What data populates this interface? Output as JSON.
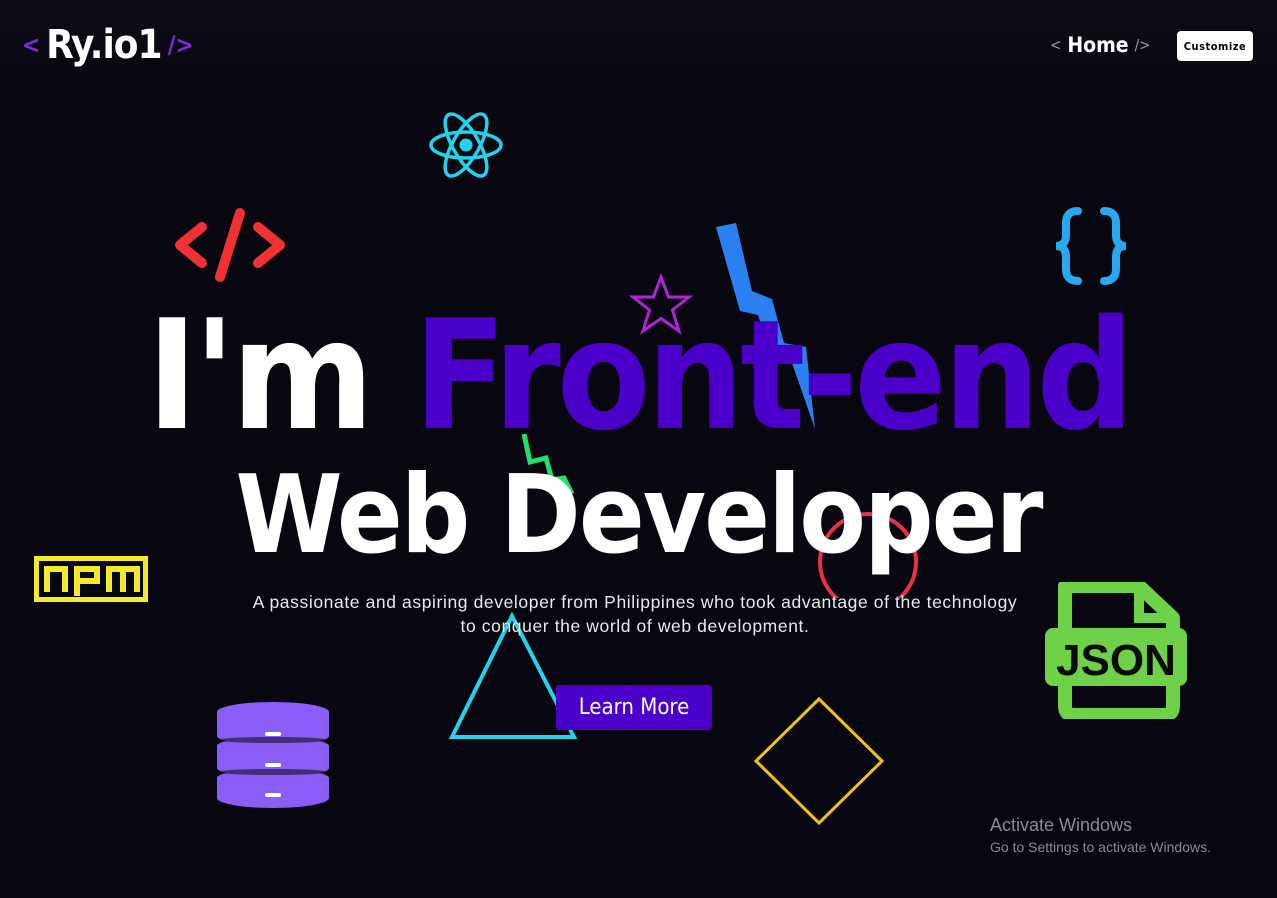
{
  "nav": {
    "logo": {
      "open": "<",
      "name": "Ry.io1",
      "close": "/>"
    },
    "home": {
      "open": "<",
      "label": "Home",
      "close": "/>"
    },
    "customize_label": "Customize"
  },
  "hero": {
    "line1_a": "I'm",
    "line1_b": "Front-end",
    "line2": "Web Developer",
    "description_1": "A passionate and aspiring developer from Philippines who took advantage of the technology",
    "description_2": "to conquer the world of web development.",
    "cta_label": "Learn More"
  },
  "decorations": {
    "npm_text": "npm",
    "json_text": "JSON",
    "icons": [
      "react-icon",
      "code-tag-icon",
      "curly-braces-icon",
      "star-icon",
      "lightning-icon",
      "npm-icon",
      "database-icon",
      "triangle-icon",
      "circle-icon",
      "diamond-icon",
      "json-file-icon"
    ]
  },
  "watermark": {
    "title": "Activate Windows",
    "subtitle": "Go to Settings to activate Windows."
  },
  "colors": {
    "background": "#08070f",
    "accent": "#4a00c8",
    "react": "#22d3ee",
    "code_tag": "#f03232",
    "braces": "#29a8f0",
    "star": "#b024d8",
    "lightning_blue": "#2c7ff0",
    "lightning_green": "#1fe06a",
    "npm": "#f3ea2b",
    "database": "#8b5cf6",
    "triangle": "#22d3ee",
    "circle": "#e8304a",
    "diamond": "#f0c020",
    "json": "#6fd14a"
  }
}
